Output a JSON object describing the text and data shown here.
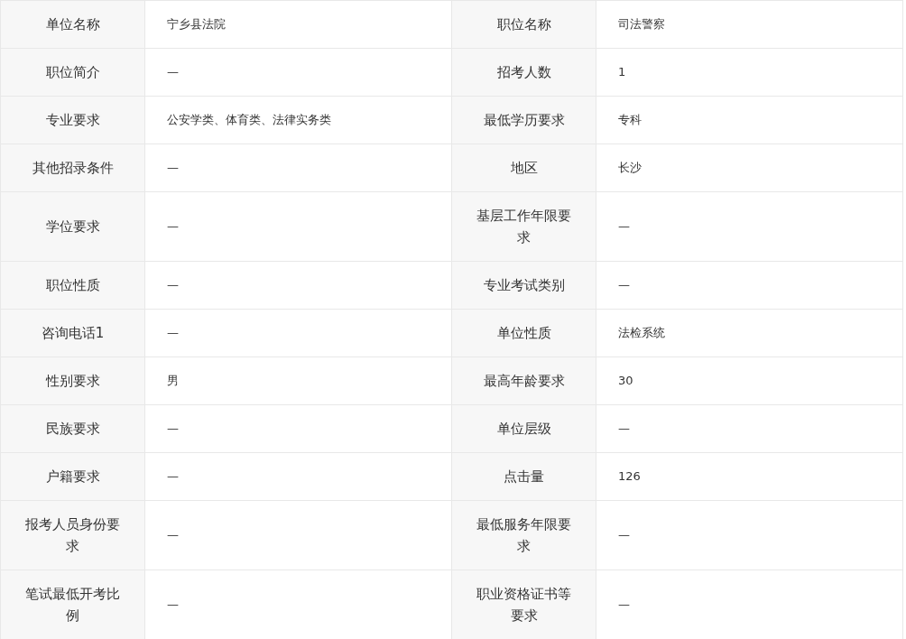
{
  "rows": [
    {
      "left": {
        "label": "单位名称",
        "value": "宁乡县法院"
      },
      "right": {
        "label": "职位名称",
        "value": "司法警察"
      }
    },
    {
      "left": {
        "label": "职位简介",
        "value": "—"
      },
      "right": {
        "label": "招考人数",
        "value": "1"
      }
    },
    {
      "left": {
        "label": "专业要求",
        "value": "公安学类、体育类、法律实务类"
      },
      "right": {
        "label": "最低学历要求",
        "value": "专科"
      }
    },
    {
      "left": {
        "label": "其他招录条件",
        "value": "—"
      },
      "right": {
        "label": "地区",
        "value": "长沙"
      }
    },
    {
      "left": {
        "label": "学位要求",
        "value": "—"
      },
      "right": {
        "label": "基层工作年限要求",
        "value": "—"
      }
    },
    {
      "left": {
        "label": "职位性质",
        "value": "—"
      },
      "right": {
        "label": "专业考试类别",
        "value": "—"
      }
    },
    {
      "left": {
        "label": "咨询电话1",
        "value": "—"
      },
      "right": {
        "label": "单位性质",
        "value": "法检系统"
      }
    },
    {
      "left": {
        "label": "性别要求",
        "value": "男"
      },
      "right": {
        "label": "最高年龄要求",
        "value": "30"
      }
    },
    {
      "left": {
        "label": "民族要求",
        "value": "—"
      },
      "right": {
        "label": "单位层级",
        "value": "—"
      }
    },
    {
      "left": {
        "label": "户籍要求",
        "value": "—"
      },
      "right": {
        "label": "点击量",
        "value": "126"
      }
    },
    {
      "left": {
        "label": "报考人员身份要求",
        "value": "—"
      },
      "right": {
        "label": "最低服务年限要求",
        "value": "—"
      }
    },
    {
      "left": {
        "label": "笔试最低开考比例",
        "value": "—"
      },
      "right": {
        "label": "职业资格证书等要求",
        "value": "—"
      }
    }
  ]
}
